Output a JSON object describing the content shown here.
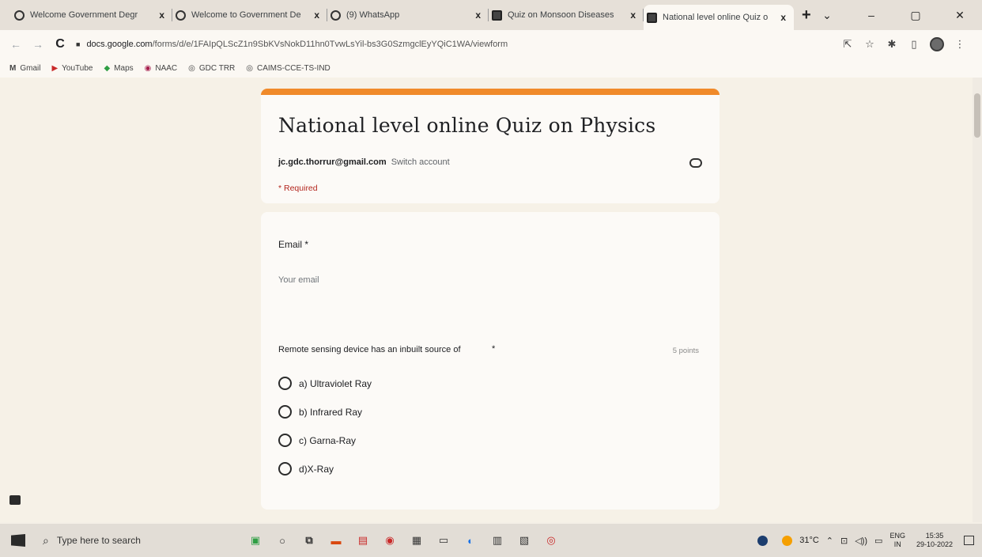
{
  "browser": {
    "tabs": [
      {
        "title": "Welcome Government Degr",
        "close": "x",
        "icon": "globe-icon"
      },
      {
        "title": "Welcome to Government De",
        "close": "x",
        "icon": "globe-icon"
      },
      {
        "title": "(9) WhatsApp",
        "close": "x",
        "icon": "whatsapp-icon"
      },
      {
        "title": "Quiz on Monsoon Diseases",
        "close": "x",
        "icon": "forms-icon"
      },
      {
        "title": "National level online Quiz o",
        "close": "x",
        "icon": "forms-icon"
      }
    ],
    "new_tab": "+",
    "window_controls": {
      "dropdown": "⌄",
      "minimize": "–",
      "restore": "▢",
      "close": "✕"
    },
    "url_host": "docs.google.com",
    "url_path": "/forms/d/e/1FAIpQLScZ1n9SbKVsNokD11hn0TvwLsYil-bs3G0SzmgclEyYQiC1WA/viewform",
    "bookmarks": [
      {
        "label": "Gmail",
        "icon": "M"
      },
      {
        "label": "YouTube",
        "icon": "▶"
      },
      {
        "label": "Maps",
        "icon": "◆"
      },
      {
        "label": "NAAC",
        "icon": "◉"
      },
      {
        "label": "GDC TRR",
        "icon": "◎"
      },
      {
        "label": "CAIMS-CCE-TS-IND",
        "icon": "◎"
      }
    ]
  },
  "form": {
    "title": "National level online Quiz on Physics",
    "account_email": "jc.gdc.thorrur@gmail.com",
    "switch_account": "Switch account",
    "required_note": "* Required",
    "email_question": {
      "label": "Email",
      "required_mark": "*",
      "placeholder": "Your email"
    },
    "question": {
      "text": "Remote sensing device has an inbuilt source of",
      "required_mark": "*",
      "points": "5 points",
      "options": [
        "a) Ultraviolet Ray",
        "b) Infrared Ray",
        "c) Garna-Ray",
        "d)X-Ray"
      ]
    }
  },
  "taskbar": {
    "search_placeholder": "Type here to search",
    "weather": "31°C",
    "language": "ENG",
    "region": "IN",
    "time": "15:35",
    "date": "29-10-2022"
  },
  "colors": {
    "accent": "#f08a2a",
    "required": "#b3261e"
  }
}
